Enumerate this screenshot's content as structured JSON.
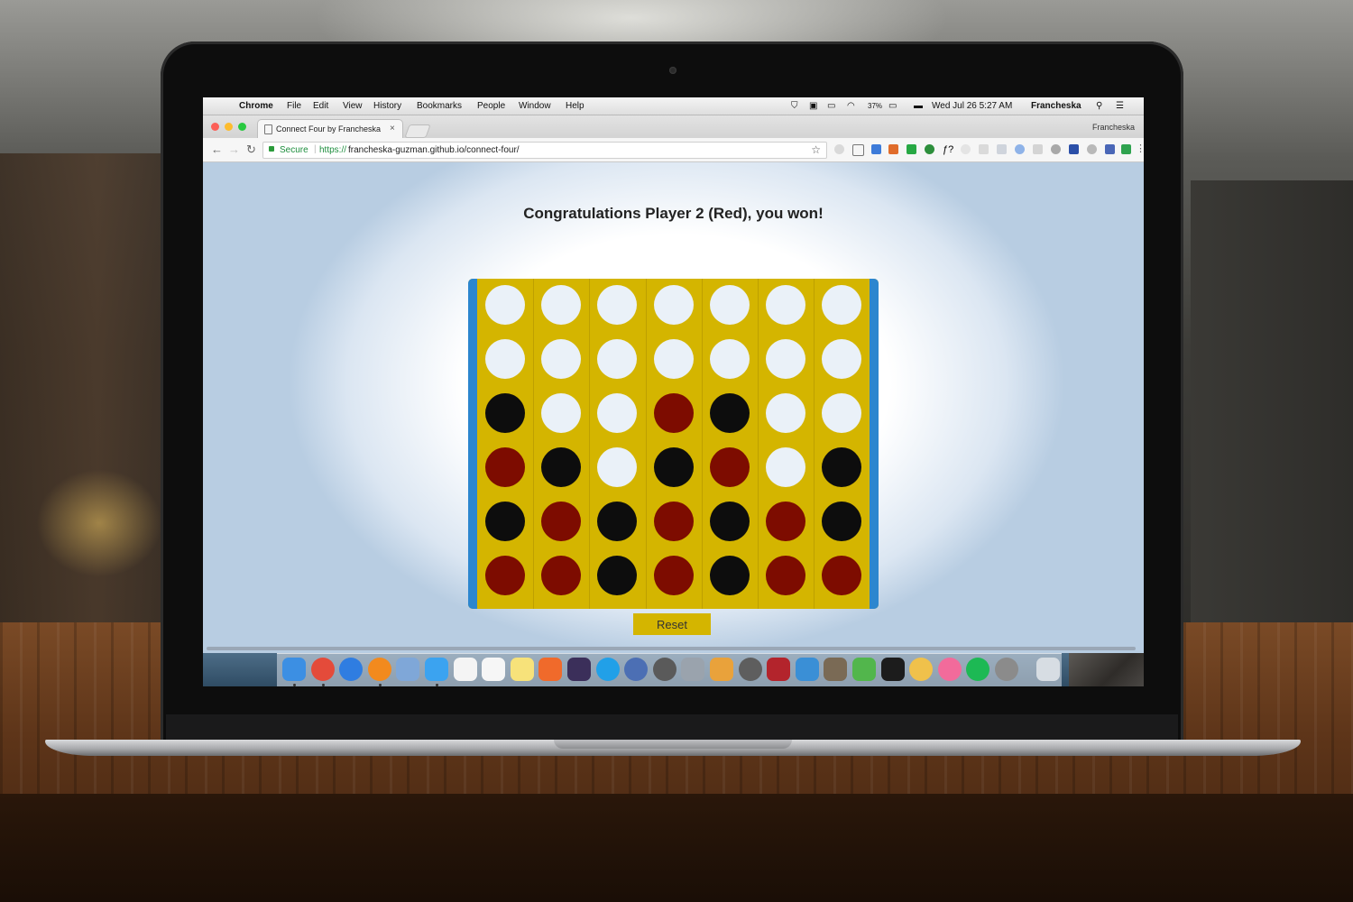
{
  "menubar": {
    "items": [
      "Chrome",
      "File",
      "Edit",
      "View",
      "History",
      "Bookmarks",
      "People",
      "Window",
      "Help"
    ],
    "status": {
      "battery": "37%",
      "datetime": "Wed Jul 26  5:27 AM",
      "user": "Francheska"
    }
  },
  "browser": {
    "tab_title": "Connect Four by Francheska",
    "tab_close": "×",
    "profile_name": "Francheska",
    "secure_label": "Secure",
    "url_scheme": "https://",
    "url_rest": "francheska-guzman.github.io/connect-four/",
    "nav": {
      "back": "←",
      "forward": "→",
      "reload": "↻",
      "star": "☆"
    }
  },
  "game": {
    "message": "Congratulations Player 2 (Red), you won!",
    "reset_label": "Reset",
    "board": [
      [
        "empty",
        "empty",
        "empty",
        "empty",
        "empty",
        "empty",
        "empty"
      ],
      [
        "empty",
        "empty",
        "empty",
        "empty",
        "empty",
        "empty",
        "empty"
      ],
      [
        "black",
        "empty",
        "empty",
        "red",
        "black",
        "empty",
        "empty"
      ],
      [
        "red",
        "black",
        "empty",
        "black",
        "red",
        "empty",
        "black"
      ],
      [
        "black",
        "red",
        "black",
        "red",
        "black",
        "red",
        "black"
      ],
      [
        "red",
        "red",
        "black",
        "red",
        "black",
        "red",
        "red"
      ]
    ]
  },
  "colors": {
    "board": "#d4b500",
    "board_sides": "#2c86cf",
    "red_piece": "#7d0c00",
    "black_piece": "#0d0d0d",
    "empty_slot": "#eaf1f8"
  },
  "dock": {
    "apps": [
      "finder",
      "chrome",
      "safari",
      "firefox",
      "preview",
      "messages",
      "calendar",
      "textedit",
      "notes",
      "git",
      "slack",
      "twitterific",
      "pixelmator",
      "quicktime",
      "sequel-pro",
      "sketch",
      "mindnode",
      "dictionary",
      "ink",
      "screenshot",
      "evernote",
      "terminal",
      "photos",
      "itunes",
      "spotify",
      "system-preferences",
      "trash"
    ]
  }
}
